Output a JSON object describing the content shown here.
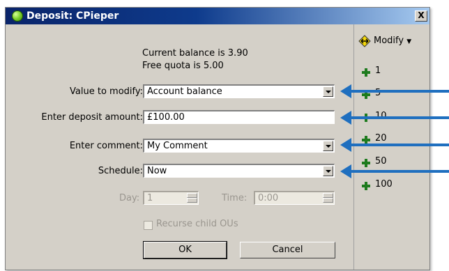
{
  "colors": {
    "title_bar": "#0a246a",
    "dialog_bg": "#d4d0c8",
    "plus_icon": "#1e7b1e",
    "annotation_arrow": "#1f6fbf"
  },
  "window": {
    "title": "Deposit: CPieper",
    "close_label": "X"
  },
  "info": {
    "balance_text": "Current balance is 3.90",
    "quota_text": "Free quota is 5.00"
  },
  "form": {
    "value_to_modify": {
      "label": "Value to modify:",
      "value": "Account balance"
    },
    "deposit_amount": {
      "label": "Enter deposit amount:",
      "value": "£100.00"
    },
    "comment": {
      "label": "Enter comment:",
      "value": "My Comment"
    },
    "schedule": {
      "label": "Schedule:",
      "value": "Now"
    },
    "day": {
      "label": "Day:",
      "value": "1"
    },
    "time": {
      "label": "Time:",
      "value": "0:00"
    },
    "recurse": {
      "label": "Recurse child OUs",
      "checked": false
    }
  },
  "buttons": {
    "ok": "OK",
    "cancel": "Cancel"
  },
  "side_panel": {
    "modify_label": "Modify",
    "items": [
      "1",
      "5",
      "10",
      "20",
      "50",
      "100"
    ]
  }
}
